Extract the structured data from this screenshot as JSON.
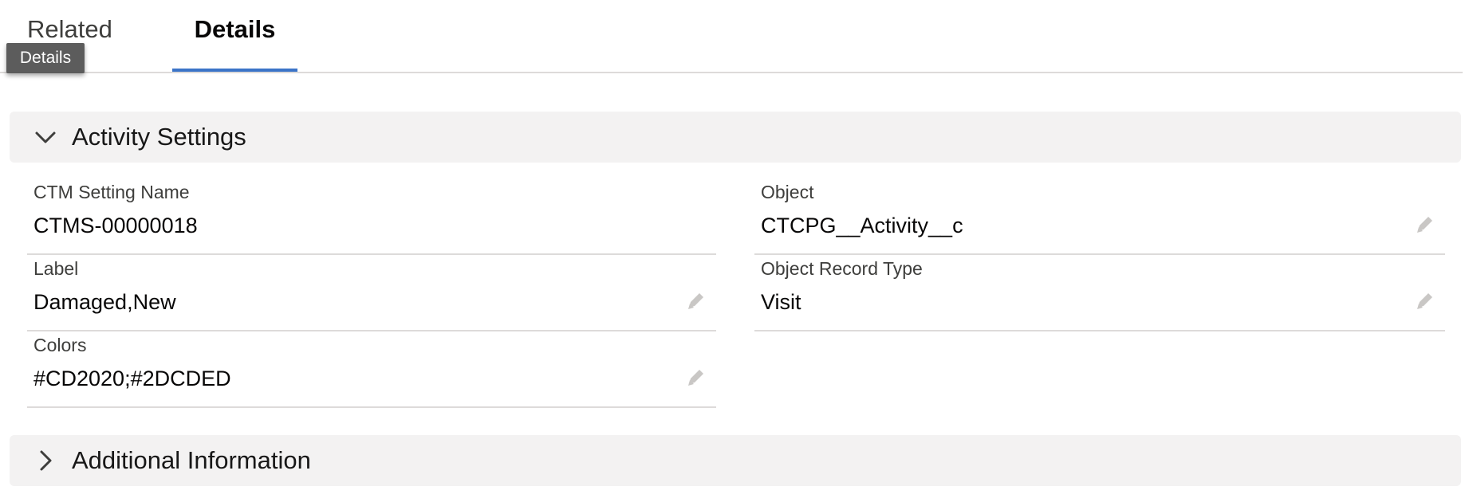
{
  "tabs": {
    "related_label": "Related",
    "details_label": "Details",
    "tooltip": "Details"
  },
  "sections": {
    "activity_settings": {
      "title": "Activity Settings",
      "expanded": true
    },
    "additional_information": {
      "title": "Additional Information",
      "expanded": false
    }
  },
  "fields": {
    "ctm_setting_name": {
      "label": "CTM Setting Name",
      "value": "CTMS-00000018"
    },
    "object": {
      "label": "Object",
      "value": "CTCPG__Activity__c"
    },
    "label": {
      "label": "Label",
      "value": "Damaged,New"
    },
    "object_record_type": {
      "label": "Object Record Type",
      "value": "Visit"
    },
    "colors": {
      "label": "Colors",
      "value": "#CD2020;#2DCDED"
    }
  },
  "colors": {
    "active_tab_underline": "#3b74c8",
    "section_header_bg": "#f3f2f2",
    "field_divider": "#dddbda"
  }
}
